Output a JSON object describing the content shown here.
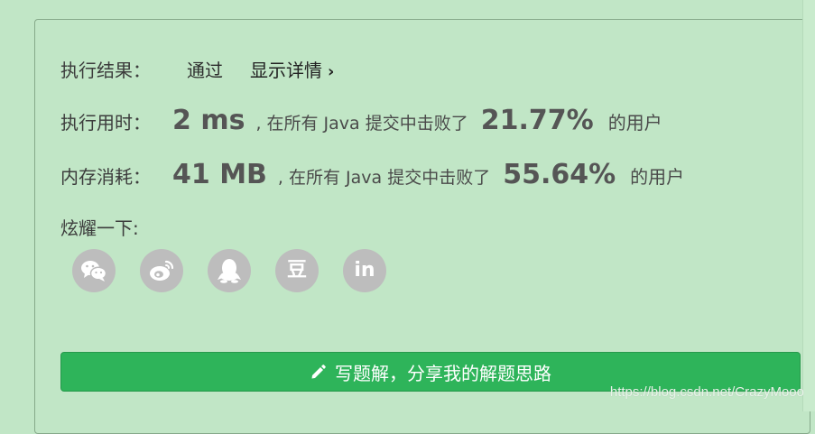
{
  "result": {
    "label": "执行结果：",
    "value": "通过",
    "detail_link": "显示详情",
    "detail_chevron": "›"
  },
  "runtime": {
    "label": "执行用时：",
    "metric": "2 ms",
    "sentence": ", 在所有 Java 提交中击败了",
    "percent": "21.77%",
    "tail": "的用户"
  },
  "memory": {
    "label": "内存消耗：",
    "metric": "41 MB",
    "sentence": ", 在所有 Java 提交中击败了",
    "percent": "55.64%",
    "tail": "的用户"
  },
  "share": {
    "label": "炫耀一下:",
    "icons": [
      {
        "name": "wechat-icon"
      },
      {
        "name": "weibo-icon"
      },
      {
        "name": "qq-icon"
      },
      {
        "name": "douban-icon",
        "glyph": "豆"
      },
      {
        "name": "linkedin-icon",
        "glyph": "in"
      }
    ]
  },
  "write_button": {
    "label": "写题解，分享我的解题思路"
  },
  "watermark": "https://blog.csdn.net/CrazyMooo",
  "colors": {
    "background": "#c1e6c6",
    "button": "#2eb45a",
    "icon_circle": "#bdbdbd",
    "text": "#333333"
  }
}
